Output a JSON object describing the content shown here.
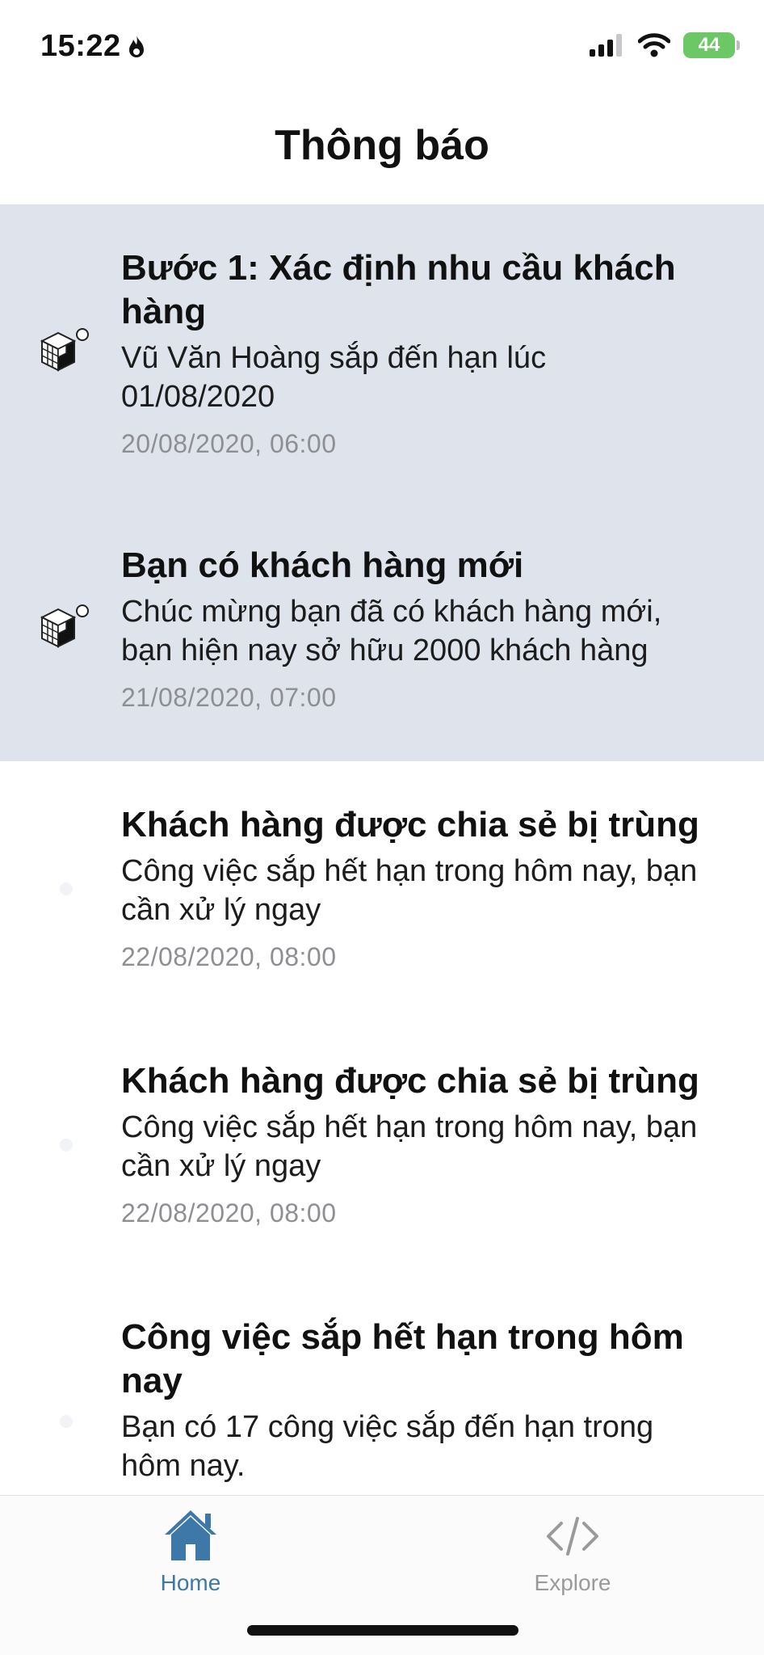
{
  "status_bar": {
    "time": "15:22",
    "battery": "44"
  },
  "header": {
    "title": "Thông báo"
  },
  "notifications": [
    {
      "title": "Bước 1: Xác định nhu cầu khách hàng",
      "body": "Vũ Văn Hoàng sắp đến hạn lúc 01/08/2020",
      "time": "20/08/2020, 06:00",
      "unread": true,
      "icon": "cube-icon"
    },
    {
      "title": "Bạn có khách hàng mới",
      "body": "Chúc mừng bạn đã có khách hàng mới, bạn hiện nay sở hữu 2000 khách hàng",
      "time": "21/08/2020, 07:00",
      "unread": true,
      "icon": "cube-icon"
    },
    {
      "title": "Khách hàng được chia sẻ bị trùng",
      "body": "Công việc sắp hết hạn trong hôm nay, bạn cần xử lý ngay",
      "time": "22/08/2020, 08:00",
      "unread": false,
      "icon": "dot-icon"
    },
    {
      "title": "Khách hàng được chia sẻ bị trùng",
      "body": "Công việc sắp hết hạn trong hôm nay, bạn cần xử lý ngay",
      "time": "22/08/2020, 08:00",
      "unread": false,
      "icon": "dot-icon"
    },
    {
      "title": "Công việc sắp hết hạn trong hôm nay",
      "body": "Bạn có 17 công việc sắp đến hạn trong hôm nay.",
      "time": "",
      "unread": false,
      "icon": "dot-icon"
    }
  ],
  "tabbar": {
    "home_label": "Home",
    "explore_label": "Explore",
    "active_color": "#3e78a8",
    "inactive_color": "#9a9a9a"
  },
  "colors": {
    "unread_background": "#dfe4ec",
    "battery_green": "#6cc864"
  }
}
